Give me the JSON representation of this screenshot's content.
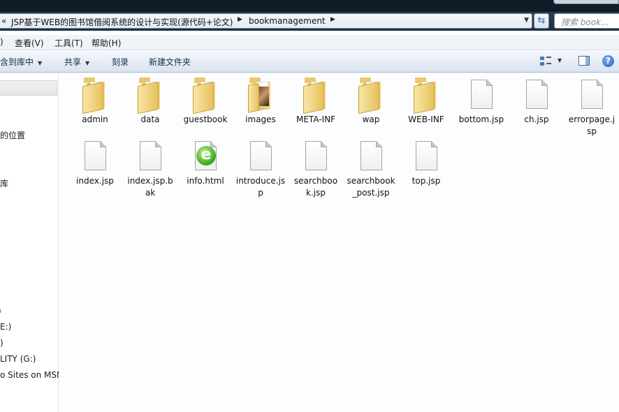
{
  "address": {
    "overflow": "«",
    "segments": [
      "JSP基于WEB的图书馆借阅系统的设计与实现(源代码+论文)",
      "bookmanagement"
    ]
  },
  "search": {
    "placeholder": "搜索 book..."
  },
  "menu": [
    ")",
    "查看(V)",
    "工具(T)",
    "帮助(H)"
  ],
  "toolbar": {
    "include_library": "含到库中",
    "share": "共享",
    "burn": "刻录",
    "new_folder": "新建文件夹",
    "help": "?"
  },
  "nav": {
    "items": [
      "的位置",
      "库",
      "E:)",
      ")",
      "LITY (G:)",
      "o Sites on MSN"
    ]
  },
  "files": [
    {
      "name": "admin",
      "kind": "folder"
    },
    {
      "name": "data",
      "kind": "folder"
    },
    {
      "name": "guestbook",
      "kind": "folder"
    },
    {
      "name": "images",
      "kind": "folder-photo"
    },
    {
      "name": "META-INF",
      "kind": "folder"
    },
    {
      "name": "wap",
      "kind": "folder"
    },
    {
      "name": "WEB-INF",
      "kind": "folder"
    },
    {
      "name": "bottom.jsp",
      "kind": "file"
    },
    {
      "name": "ch.jsp",
      "kind": "file"
    },
    {
      "name": "errorpage.jsp",
      "kind": "file"
    },
    {
      "name": "index.jsp",
      "kind": "file"
    },
    {
      "name": "index.jsp.bak",
      "kind": "file"
    },
    {
      "name": "info.html",
      "kind": "html"
    },
    {
      "name": "introduce.jsp",
      "kind": "file"
    },
    {
      "name": "searchbook.jsp",
      "kind": "file"
    },
    {
      "name": "searchbook_post.jsp",
      "kind": "file"
    },
    {
      "name": "top.jsp",
      "kind": "file"
    }
  ],
  "icons": {
    "html_glyph": "e",
    "refresh": "⇆",
    "dropdown": "▼",
    "breadcrumb_arrow": "▶"
  }
}
